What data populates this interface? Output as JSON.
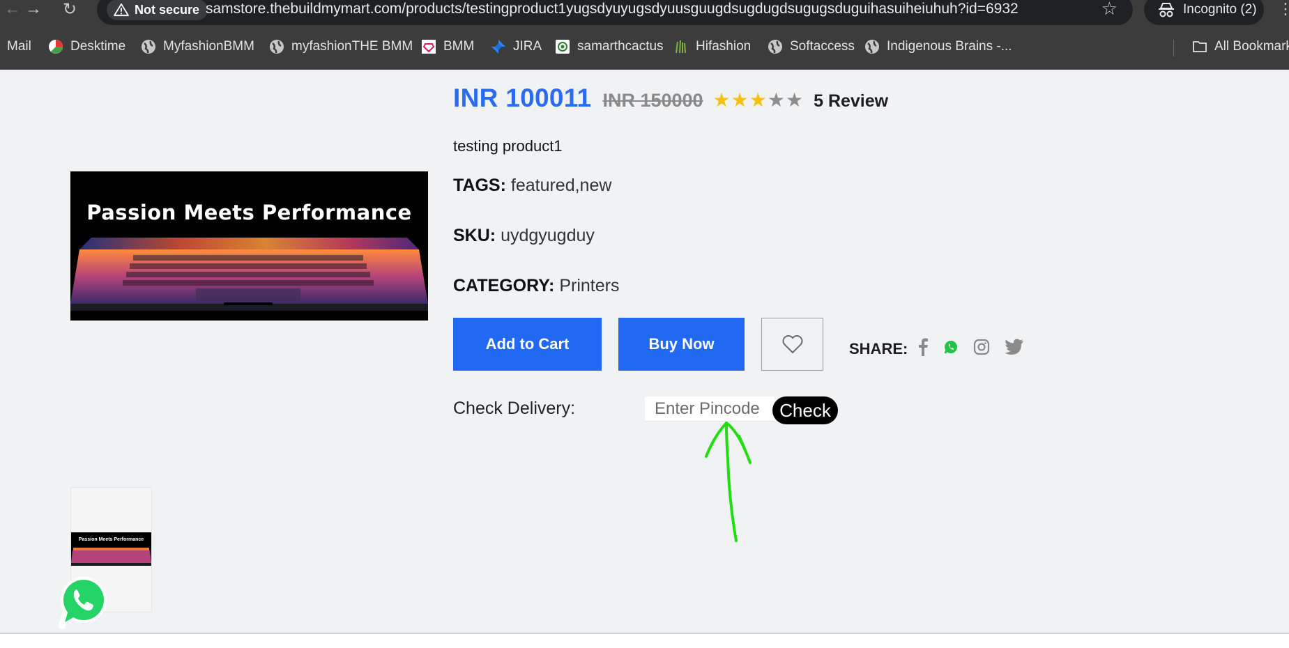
{
  "browser": {
    "security_label": "Not secure",
    "url": "samstore.thebuildmymart.com/products/testingproduct1yugsdyuyugsdyuusguugdsugdugdsugugsduguihasuiheiuhuh?id=6932",
    "incognito_label": "Incognito (2)",
    "bookmarks": [
      {
        "label": "Mail",
        "icon": "mail-icon"
      },
      {
        "label": "Desktime",
        "icon": "desktime-icon"
      },
      {
        "label": "MyfashionBMM",
        "icon": "globe-icon"
      },
      {
        "label": "myfashionTHE BMM",
        "icon": "globe-icon"
      },
      {
        "label": "BMM",
        "icon": "bmm-icon"
      },
      {
        "label": "JIRA",
        "icon": "jira-icon"
      },
      {
        "label": "samarthcactus",
        "icon": "cactus-icon"
      },
      {
        "label": "Hifashion",
        "icon": "hifashion-icon"
      },
      {
        "label": "Softaccess",
        "icon": "globe-icon"
      },
      {
        "label": "Indigenous Brains -...",
        "icon": "globe-icon"
      }
    ],
    "all_bookmarks_label": "All Bookmarks"
  },
  "product": {
    "price": "INR 100011",
    "old_price": "INR 150000",
    "rating": 3,
    "rating_max": 5,
    "review_label": "5 Review",
    "name": "testing product1",
    "tags_label": "TAGS:",
    "tags_value": "featured,new",
    "sku_label": "SKU:",
    "sku_value": "uydgyugduy",
    "category_label": "CATEGORY:",
    "category_value": "Printers",
    "image_caption": "Passion Meets Performance",
    "thumb_caption": "Passion Meets Performance"
  },
  "actions": {
    "add_to_cart": "Add to Cart",
    "buy_now": "Buy Now",
    "share_label": "SHARE:"
  },
  "delivery": {
    "label": "Check Delivery:",
    "placeholder": "Enter Pincode",
    "check_label": "Check"
  },
  "colors": {
    "accent": "#2168f2",
    "price": "#2a6bf1",
    "star": "#f4c20d",
    "annotation": "#22dd11"
  }
}
